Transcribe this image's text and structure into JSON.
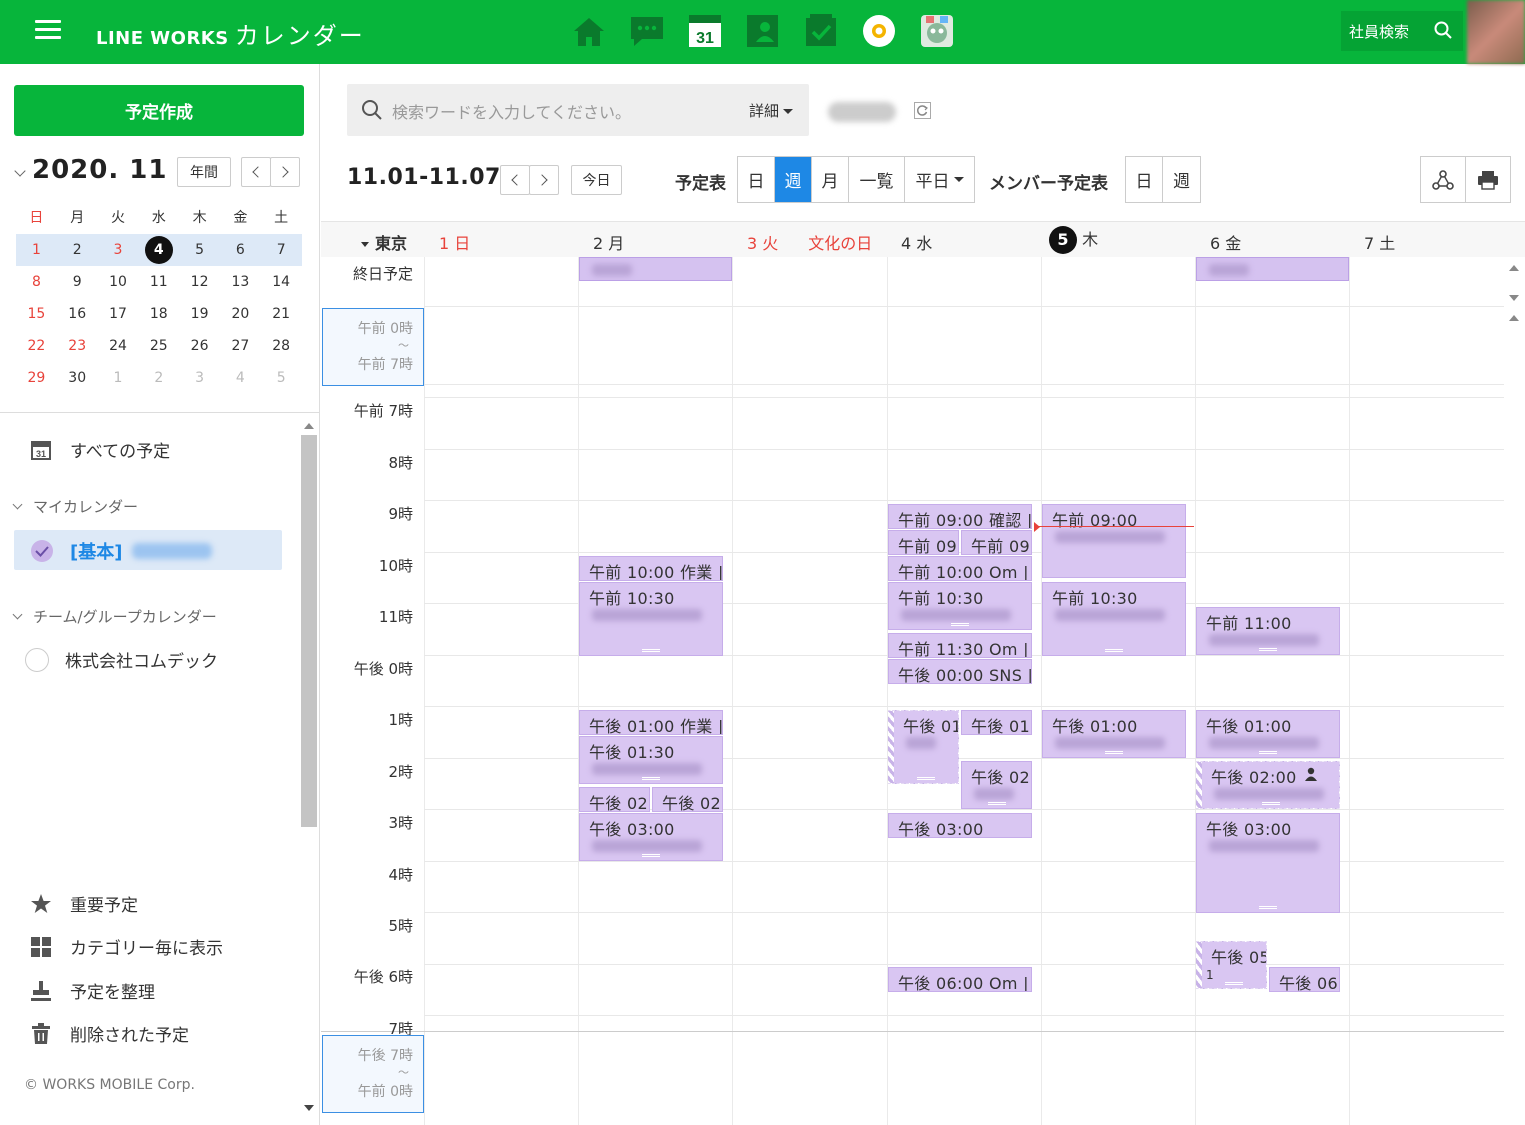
{
  "app": {
    "brand": "LINE WORKS",
    "app_name": "カレンダー",
    "employee_search": "社員検索",
    "nav_icons": [
      "home-icon",
      "talk-icon",
      "calendar-icon",
      "contacts-icon",
      "task-icon",
      "board-icon",
      "drive-icon"
    ],
    "calendar_icon_day": "31"
  },
  "sidebar": {
    "create_button": "予定作成",
    "mini_calendar": {
      "title": "2020. 11",
      "year_button": "年間",
      "weekdays": [
        "日",
        "月",
        "火",
        "水",
        "木",
        "金",
        "土"
      ],
      "weeks": [
        [
          "1",
          "2",
          "3",
          "4",
          "5",
          "6",
          "7"
        ],
        [
          "8",
          "9",
          "10",
          "11",
          "12",
          "13",
          "14"
        ],
        [
          "15",
          "16",
          "17",
          "18",
          "19",
          "20",
          "21"
        ],
        [
          "22",
          "23",
          "24",
          "25",
          "26",
          "27",
          "28"
        ],
        [
          "29",
          "30",
          "1",
          "2",
          "3",
          "4",
          "5"
        ]
      ],
      "today": "4"
    },
    "all_events": "すべての予定",
    "my_calendar_group": "マイカレンダー",
    "my_calendar_item": "[基本]",
    "team_group": "チーム/グループカレンダー",
    "team_item": "株式会社コムデック",
    "bottom_items": [
      "重要予定",
      "カテゴリー毎に表示",
      "予定を整理",
      "削除された予定"
    ],
    "copyright": "© WORKS MOBILE Corp."
  },
  "toolbar": {
    "search_placeholder": "検索ワードを入力してください。",
    "detail": "詳細",
    "range": "11.01-11.07",
    "today": "今日",
    "schedule_label": "予定表",
    "views": [
      "日",
      "週",
      "月",
      "一覧",
      "平日"
    ],
    "active_view": "週",
    "member_label": "メンバー予定表",
    "member_views": [
      "日",
      "週"
    ]
  },
  "week": {
    "timezone": "東京",
    "days": [
      {
        "num": "1",
        "dow": "日",
        "holiday": ""
      },
      {
        "num": "2",
        "dow": "月",
        "holiday": ""
      },
      {
        "num": "3",
        "dow": "火",
        "holiday": "文化の日"
      },
      {
        "num": "4",
        "dow": "水",
        "holiday": ""
      },
      {
        "num": "5",
        "dow": "木",
        "holiday": ""
      },
      {
        "num": "6",
        "dow": "金",
        "holiday": ""
      },
      {
        "num": "7",
        "dow": "土",
        "holiday": ""
      }
    ],
    "allday_label": "終日予定",
    "collapsed_top": {
      "from": "午前 0時",
      "tilde": "～",
      "to": "午前 7時"
    },
    "collapsed_bottom": {
      "from": "午後 7時",
      "tilde": "～",
      "to": "午前 0時"
    },
    "hours": [
      "午前  7時",
      "8時",
      "9時",
      "10時",
      "11時",
      "午後  0時",
      "1時",
      "2時",
      "3時",
      "4時",
      "5時",
      "午後  6時",
      "7時"
    ]
  },
  "events": {
    "mon_1": "午前 10:00 作業 |",
    "mon_2": "午前 10:30 ",
    "mon_3": "午後 01:00 作業 |",
    "mon_4": "午後 01:30",
    "mon_5": "午後 02",
    "mon_6": "午後 02",
    "mon_7": "午後 03:00",
    "wed_1": "午前 09:00 確認 |",
    "wed_2": "午前 09",
    "wed_3": "午前 09",
    "wed_4": "午前 10:00 Om |",
    "wed_5": "午前 10:30",
    "wed_6": "午前 11:30 Om | :",
    "wed_7": "午後 00:00 SNS |",
    "wed_8": "午後 01",
    "wed_9": "午後 01",
    "wed_10": "午後 02",
    "wed_11": "午後 03:00",
    "wed_12": "午後 06:00 Om |",
    "thu_1": "午前 09:00",
    "thu_2": "午前 10:30",
    "thu_3": "午後 01:00",
    "fri_1": "午前 11:00",
    "fri_2": "午後 01:00",
    "fri_3": "午後 02:00",
    "fri_4": "午後 03:00",
    "fri_5": "午後 05",
    "fri_6": "午後 06",
    "fri_5_sub": "1"
  },
  "colors": {
    "brand_green": "#07b53b",
    "event_purple": "#d9c6f2",
    "active_blue": "#1e88e5",
    "holiday_red": "#e8433b"
  }
}
